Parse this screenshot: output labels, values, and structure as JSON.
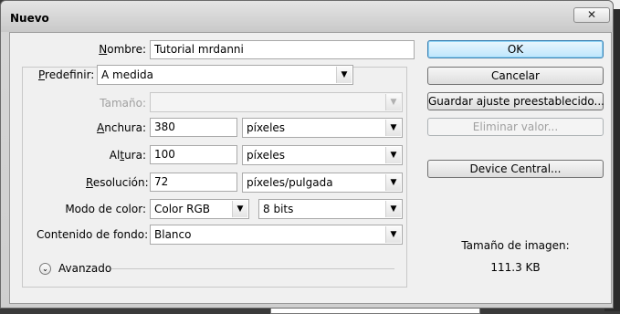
{
  "window": {
    "title": "Nuevo",
    "close_glyph": "✕"
  },
  "form": {
    "nombre": {
      "label": "Nombre:",
      "underline": "N",
      "rest": "ombre:",
      "value": "Tutorial mrdanni"
    },
    "predefinir": {
      "label_u": "P",
      "label_rest": "redefinir:",
      "value": "A medida"
    },
    "tamano": {
      "label": "Tamaño:",
      "value": ""
    },
    "anchura": {
      "label_u": "A",
      "label_rest": "nchura:",
      "value": "380",
      "unit": "píxeles"
    },
    "altura": {
      "label_pre": "Al",
      "label_u": "t",
      "label_rest": "ura:",
      "value": "100",
      "unit": "píxeles"
    },
    "resolucion": {
      "label_u": "R",
      "label_rest": "esolución:",
      "value": "72",
      "unit": "píxeles/pulgada"
    },
    "modo_color": {
      "label": "Modo de color:",
      "value": "Color RGB",
      "bits": "8 bits"
    },
    "contenido_fondo": {
      "label": "Contenido de fondo:",
      "value": "Blanco"
    },
    "avanzado": {
      "label": "Avanzado",
      "glyph": "⌄"
    }
  },
  "buttons": {
    "ok": "OK",
    "cancelar": "Cancelar",
    "guardar": "Guardar ajuste preestablecido...",
    "eliminar": "Eliminar valor...",
    "device_central": "Device Central..."
  },
  "info": {
    "label": "Tamaño de imagen:",
    "value": "111.3 KB"
  },
  "icons": {
    "dropdown_arrow": "▼",
    "close": "close-icon",
    "expand": "chevron-down-icon"
  }
}
